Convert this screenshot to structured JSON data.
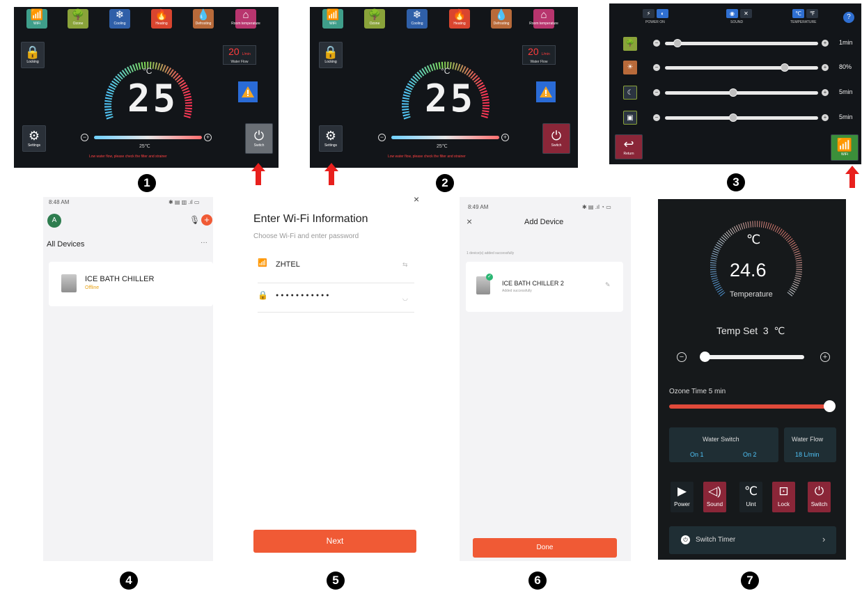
{
  "screen1": {
    "modes": [
      {
        "icon": "wifi-icon",
        "label": "WiFi",
        "color": "#3f9e8a"
      },
      {
        "icon": "ozone-icon",
        "label": "Ozone",
        "color": "#8aa33a"
      },
      {
        "icon": "snowflake-icon",
        "label": "Cooling",
        "color": "#2f5fa8"
      },
      {
        "icon": "flame-icon",
        "label": "Heating",
        "color": "#d9452f"
      },
      {
        "icon": "defrost-icon",
        "label": "Defrosting",
        "color": "#b86a3a"
      },
      {
        "icon": "home-icon",
        "label": "Room temperature",
        "color": "#b8356e"
      }
    ],
    "locking_label": "Locking",
    "flow_value": "20",
    "flow_unit": "L/min",
    "flow_label": "Water Flow",
    "unit": "°C",
    "temperature": "25",
    "settings_label": "Settings",
    "set_temp": "25℃",
    "switch_label": "Switch",
    "warning": "Low water flow, please check the filter and strainer"
  },
  "screen3": {
    "headers": [
      {
        "label": "POWER ON"
      },
      {
        "label": "SOUND"
      },
      {
        "label": "TEMPERATURE"
      }
    ],
    "rows": [
      {
        "value": "1min",
        "fraction": 0.06
      },
      {
        "value": "80%",
        "fraction": 0.8
      },
      {
        "value": "5min",
        "fraction": 0.44
      },
      {
        "value": "5min",
        "fraction": 0.44
      }
    ],
    "return_label": "Return",
    "wifi_label": "WiFi",
    "help": "?"
  },
  "markers": [
    "1",
    "2",
    "3",
    "4",
    "5",
    "6",
    "7"
  ],
  "screen4": {
    "time": "8:48 AM",
    "avatar": "A",
    "section": "All Devices",
    "more": "···",
    "device_name": "ICE BATH CHILLER",
    "device_status": "Offline"
  },
  "screen5": {
    "close": "×",
    "title": "Enter Wi-Fi Information",
    "subtitle": "Choose Wi-Fi and enter password",
    "ssid": "ZHTEL",
    "password": "●●●●●●●●●●●",
    "next": "Next"
  },
  "screen6": {
    "time": "8:49 AM",
    "close": "×",
    "title": "Add Device",
    "summary": "1 device(s) added successfully",
    "device_name": "ICE BATH CHILLER 2",
    "device_status": "Added successfully",
    "done": "Done"
  },
  "screen7": {
    "unit": "℃",
    "temperature": "24.6",
    "temp_label": "Temperature",
    "temp_set_label": "Temp Set",
    "temp_set_value": "3",
    "temp_set_unit": "℃",
    "ozone_label": "Ozone Time 5 min",
    "water_switch_label": "Water Switch",
    "on1": "On 1",
    "on2": "On 2",
    "water_flow_label": "Water Flow",
    "water_flow_value": "18 L/min",
    "buttons": [
      {
        "icon": "play-icon",
        "glyph": "▶",
        "label": "Power",
        "color": "#1b2226"
      },
      {
        "icon": "speaker-icon",
        "glyph": "🔈",
        "label": "Sound",
        "color": "#8a2638"
      },
      {
        "icon": "celsius-icon",
        "glyph": "℃",
        "label": "Uint",
        "color": "#1b2226"
      },
      {
        "icon": "lock-icon",
        "glyph": "🔒",
        "label": "Lock",
        "color": "#8a2638"
      },
      {
        "icon": "power-icon",
        "glyph": "⏻",
        "label": "Switch",
        "color": "#8a2638"
      }
    ],
    "timer_label": "Switch Timer",
    "timer_chevron": "›"
  }
}
